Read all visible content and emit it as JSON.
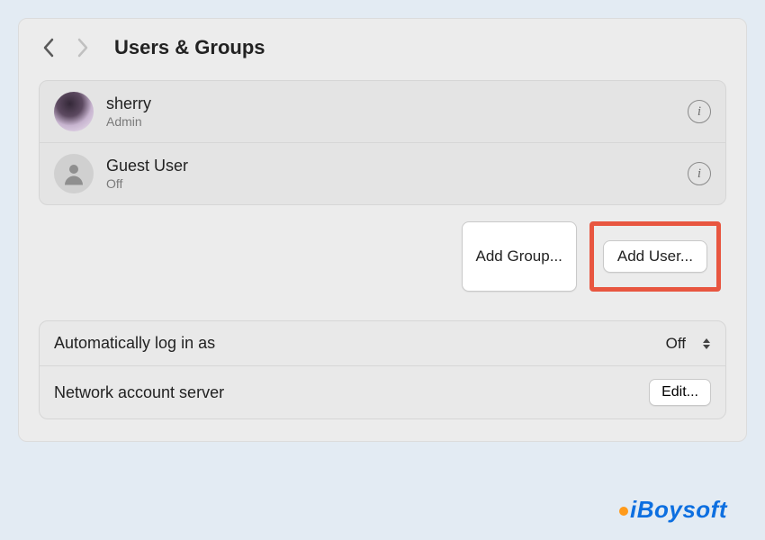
{
  "header": {
    "title": "Users & Groups"
  },
  "users": [
    {
      "name": "sherry",
      "subtitle": "Admin",
      "avatar_kind": "photo"
    },
    {
      "name": "Guest User",
      "subtitle": "Off",
      "avatar_kind": "generic"
    }
  ],
  "buttons": {
    "add_group": "Add Group...",
    "add_user": "Add User..."
  },
  "settings": {
    "auto_login_label": "Automatically log in as",
    "auto_login_value": "Off",
    "network_server_label": "Network account server",
    "edit_button": "Edit..."
  },
  "brand": {
    "text": "iBoysoft",
    "color": "#0d6fe0",
    "dot_color": "#ff9a1a"
  },
  "info_glyph": "i"
}
